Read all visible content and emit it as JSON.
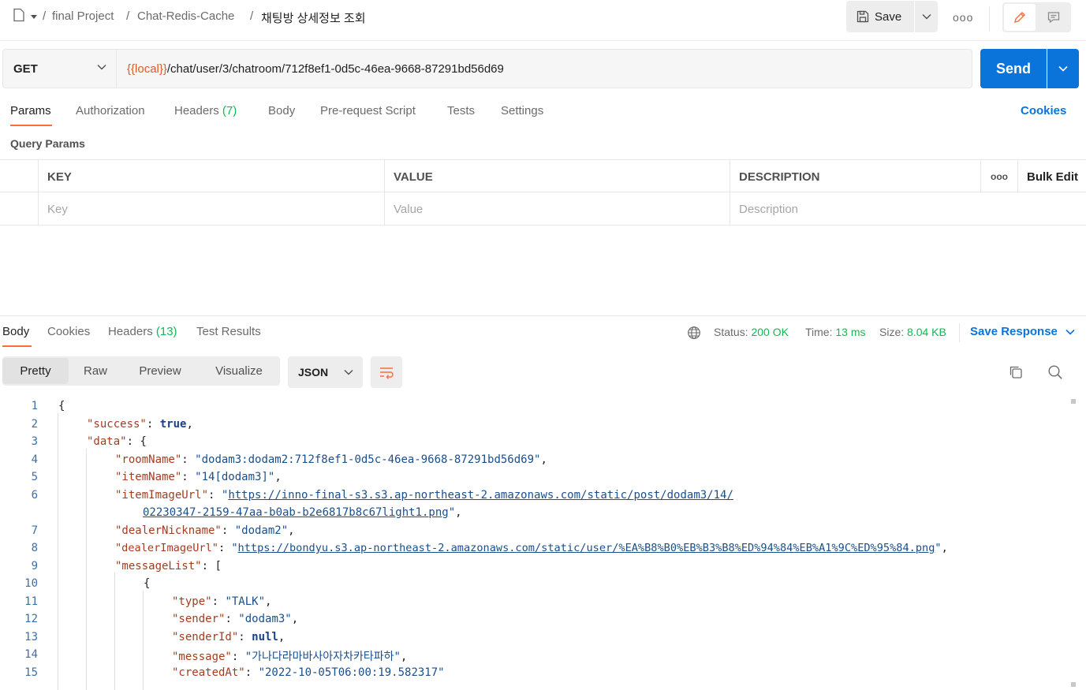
{
  "breadcrumb": {
    "workspace": "final Project",
    "collection": "Chat-Redis-Cache",
    "request": "채팅방 상세정보 조회",
    "sep": "/"
  },
  "toolbar": {
    "save_label": "Save",
    "more": "ooo"
  },
  "request": {
    "method": "GET",
    "url_var": "{{local}}",
    "url_path": "/chat/user/3/chatroom/712f8ef1-0d5c-46ea-9668-87291bd56d69",
    "send_label": "Send"
  },
  "request_tabs": [
    {
      "label": "Params"
    },
    {
      "label": "Authorization"
    },
    {
      "label": "Headers",
      "count": "(7)"
    },
    {
      "label": "Body"
    },
    {
      "label": "Pre-request Script"
    },
    {
      "label": "Tests"
    },
    {
      "label": "Settings"
    }
  ],
  "cookies_link": "Cookies",
  "query_params": {
    "title": "Query Params",
    "headers": {
      "key": "KEY",
      "value": "VALUE",
      "description": "DESCRIPTION",
      "more": "ooo",
      "bulk_edit": "Bulk Edit"
    },
    "placeholders": {
      "key": "Key",
      "value": "Value",
      "description": "Description"
    }
  },
  "response": {
    "tabs": [
      {
        "label": "Body"
      },
      {
        "label": "Cookies"
      },
      {
        "label": "Headers",
        "count": "(13)"
      },
      {
        "label": "Test Results"
      }
    ],
    "status_label": "Status:",
    "status_value": "200 OK",
    "time_label": "Time:",
    "time_value": "13 ms",
    "size_label": "Size:",
    "size_value": "8.04 KB",
    "save_response": "Save Response",
    "views": [
      "Pretty",
      "Raw",
      "Preview",
      "Visualize"
    ],
    "format": "JSON"
  },
  "code": {
    "line_numbers": [
      "1",
      "2",
      "3",
      "4",
      "5",
      "6",
      "",
      "7",
      "8",
      "9",
      "10",
      "11",
      "12",
      "13",
      "14",
      "15"
    ],
    "l1": "{",
    "l2k": "\"success\"",
    "l2v": "true",
    "l3k": "\"data\"",
    "l3v": "{",
    "l4k": "\"roomName\"",
    "l4v": "\"dodam3:dodam2:712f8ef1-0d5c-46ea-9668-87291bd56d69\"",
    "l5k": "\"itemName\"",
    "l5v": "\"14[dodam3]\"",
    "l6k": "\"itemImageUrl\"",
    "l6v": "https://inno-final-s3.s3.ap-northeast-2.amazonaws.com/static/post/dodam3/14/",
    "l6b": "02230347-2159-47aa-b0ab-b2e6817b8c67light1.png",
    "l7k": "\"dealerNickname\"",
    "l7v": "\"dodam2\"",
    "l8k": "\"dealerImageUrl\"",
    "l8v": "https://bondyu.s3.ap-northeast-2.amazonaws.com/static/user/%EA%B8%B0%EB%B3%B8%ED%94%84%EB%A1%9C%ED%95%84.png",
    "l9k": "\"messageList\"",
    "l9v": "[",
    "l10": "{",
    "l11k": "\"type\"",
    "l11v": "\"TALK\"",
    "l12k": "\"sender\"",
    "l12v": "\"dodam3\"",
    "l13k": "\"senderId\"",
    "l13v": "null",
    "l14k": "\"message\"",
    "l14v": "\"가나다라마바사아자차카타파하\"",
    "l15k": "\"createdAt\"",
    "l15v": "\"2022-10-05T06:00:19.582317\""
  }
}
